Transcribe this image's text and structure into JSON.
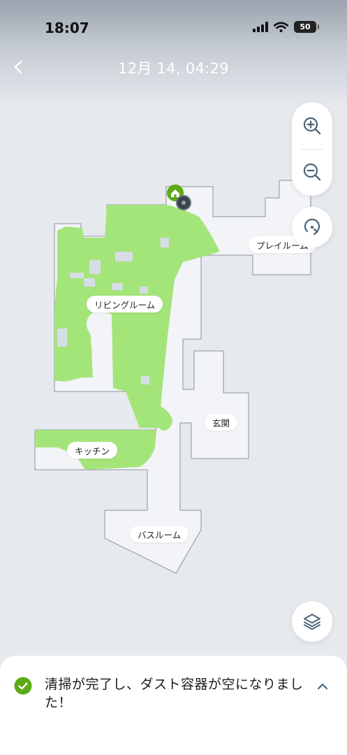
{
  "status_bar": {
    "time": "18:07",
    "battery_level": "50",
    "icons": [
      "signal-icon",
      "wifi-icon",
      "battery-icon"
    ]
  },
  "nav": {
    "title": "12月 14, 04:29",
    "back_icon": "chevron-left-icon"
  },
  "map_controls": {
    "zoom_in_icon": "zoom-in-icon",
    "zoom_out_icon": "zoom-out-icon",
    "rotate_icon": "rotate-icon",
    "layers_icon": "layers-icon"
  },
  "rooms": [
    {
      "id": "living",
      "label": "リビングルーム"
    },
    {
      "id": "play",
      "label": "プレイルーム"
    },
    {
      "id": "entrance",
      "label": "玄関"
    },
    {
      "id": "kitchen",
      "label": "キッチン"
    },
    {
      "id": "bath",
      "label": "バスルーム"
    }
  ],
  "map_markers": {
    "dock_icon": "home-icon",
    "robot_icon": "robot-icon"
  },
  "colors": {
    "floor": "#f2f4f7",
    "wall": "#8c939c",
    "cleaned": "#a4e57a",
    "dock": "#5cab14",
    "robot": "#3b424b",
    "success": "#5cab14",
    "accent_icon": "#4b6478"
  },
  "notification": {
    "message": "清掃が完了し、ダスト容器が空になりました！",
    "status_icon": "check-circle-icon",
    "expand_icon": "chevron-up-icon"
  }
}
